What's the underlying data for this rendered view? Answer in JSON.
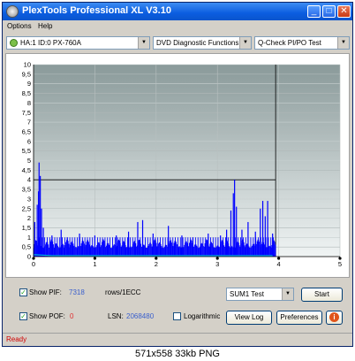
{
  "window": {
    "title": "PlexTools Professional XL V3.10",
    "buttons": {
      "minimize": "_",
      "maximize": "□",
      "close": "✕"
    }
  },
  "menu": [
    "Options",
    "Help"
  ],
  "toolbar": {
    "drive": "HA:1 ID:0  PX-760A",
    "function": "DVD Diagnostic Functions",
    "test": "Q-Check PI/PO Test"
  },
  "chart_data": {
    "type": "bar",
    "x_ticks": [
      "0",
      "1",
      "2",
      "3",
      "4",
      "5"
    ],
    "y_ticks": [
      "0",
      "0,5",
      "1",
      "1,5",
      "2",
      "2,5",
      "3",
      "3,5",
      "4",
      "4,5",
      "5",
      "5,5",
      "6",
      "6,5",
      "7",
      "7,5",
      "8",
      "8,5",
      "9",
      "9,5",
      "10"
    ],
    "xlim": [
      0,
      5
    ],
    "ylim": [
      0,
      10
    ],
    "data_end_x": 3.95,
    "series": [
      {
        "color": "#0000ff",
        "peaks": [
          [
            0.02,
            1.8
          ],
          [
            0.06,
            2.7
          ],
          [
            0.08,
            3.4
          ],
          [
            0.09,
            4.9
          ],
          [
            0.11,
            4.2
          ],
          [
            0.13,
            2.5
          ],
          [
            0.16,
            1.5
          ],
          [
            0.3,
            1.1
          ],
          [
            0.45,
            1.4
          ],
          [
            0.55,
            1.0
          ],
          [
            0.75,
            1.2
          ],
          [
            1.0,
            1.1
          ],
          [
            1.35,
            1.1
          ],
          [
            1.55,
            1.3
          ],
          [
            1.7,
            1.8
          ],
          [
            1.78,
            1.9
          ],
          [
            1.95,
            1.2
          ],
          [
            2.2,
            1.6
          ],
          [
            2.42,
            1.1
          ],
          [
            2.6,
            1.0
          ],
          [
            2.85,
            1.2
          ],
          [
            3.05,
            1.1
          ],
          [
            3.15,
            1.4
          ],
          [
            3.22,
            2.4
          ],
          [
            3.26,
            3.3
          ],
          [
            3.28,
            4.0
          ],
          [
            3.31,
            2.6
          ],
          [
            3.4,
            1.4
          ],
          [
            3.5,
            1.8
          ],
          [
            3.62,
            1.3
          ],
          [
            3.7,
            2.5
          ],
          [
            3.74,
            2.9
          ],
          [
            3.78,
            2.1
          ],
          [
            3.82,
            2.9
          ],
          [
            3.9,
            1.2
          ]
        ]
      },
      {
        "color": "#00c0e0",
        "peaks": [
          [
            0,
            0.1
          ],
          [
            0.3,
            0.05
          ],
          [
            1.0,
            0.05
          ],
          [
            2.0,
            0.05
          ],
          [
            3.0,
            0.05
          ],
          [
            3.9,
            0.05
          ]
        ]
      }
    ]
  },
  "controls": {
    "show_pif_label": "Show PIF:",
    "pif_value": "7318",
    "pif_unit": "rows/1ECC",
    "show_pof_label": "Show POF:",
    "pof_value": "0",
    "lsn_label": "LSN:",
    "lsn_value": "2068480",
    "log_label": "Logarithmic",
    "sum_select": "SUM1 Test",
    "start": "Start",
    "view_log": "View Log",
    "preferences": "Preferences",
    "info_glyph": "i",
    "check_mark": "✓"
  },
  "colors": {
    "pif": "#3a5fcd",
    "pof": "#e03030",
    "lsn": "#3a5fcd",
    "status": "#d00000"
  },
  "status": "Ready",
  "footer": "571x558 33kb PNG"
}
